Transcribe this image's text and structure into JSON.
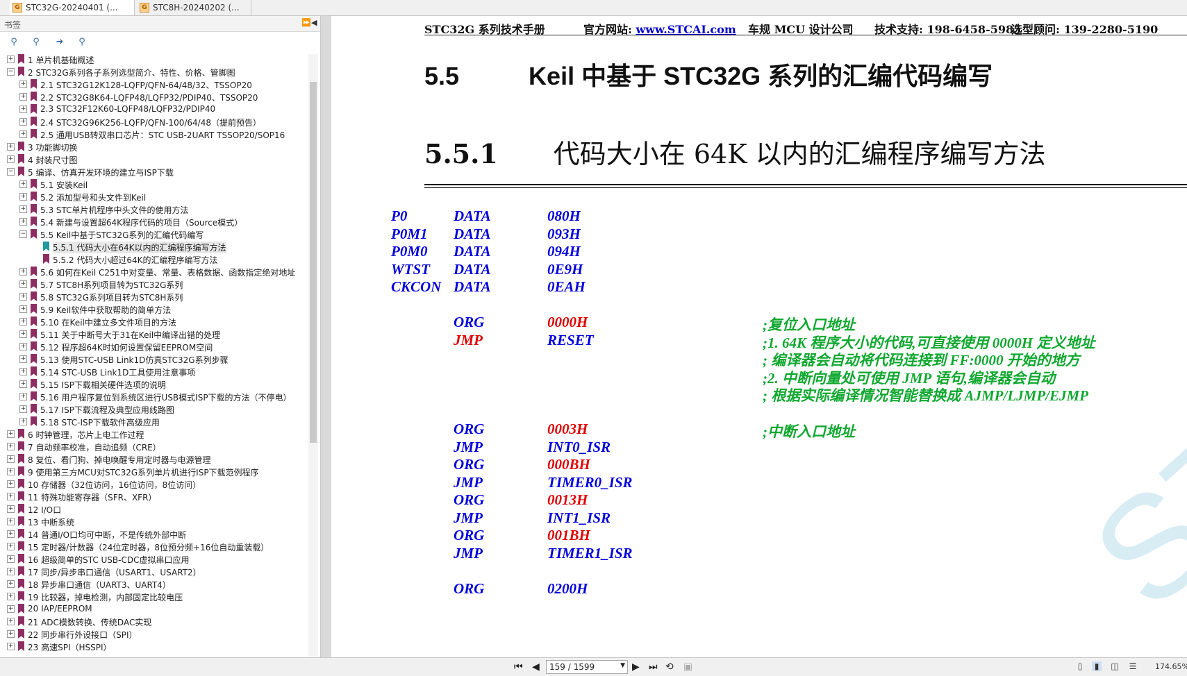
{
  "tabs": [
    {
      "label": "STC32G-20240401 (..."
    },
    {
      "label": "STC8H-20240202 (..."
    }
  ],
  "sidebar": {
    "title": "书签",
    "bookmarks": [
      {
        "text": "1 单片机基础概述",
        "level": 0
      },
      {
        "text": "2  STC32G系列各子系列选型简介、特性、价格、管脚图",
        "level": 0
      },
      {
        "text": "2.1 STC32G12K128-LQFP/QFN-64/48/32、TSSOP20",
        "level": 1
      },
      {
        "text": "2.2  STC32G8K64-LQFP48/LQFP32/PDIP40、TSSOP20",
        "level": 1
      },
      {
        "text": "2.3  STC32F12K60-LQFP48/LQFP32/PDIP40",
        "level": 1
      },
      {
        "text": "2.4  STC32G96K256-LQFP/QFN-100/64/48（提前预告）",
        "level": 1
      },
      {
        "text": "2.5  通用USB转双串口芯片：STC USB-2UART TSSOP20/SOP16",
        "level": 1
      },
      {
        "text": "3  功能脚切换",
        "level": 0
      },
      {
        "text": "4  封装尺寸图",
        "level": 0
      },
      {
        "text": "5  编译、仿真开发环境的建立与ISP下载",
        "level": 0
      },
      {
        "text": "5.1 安装Keil",
        "level": 1
      },
      {
        "text": "5.2  添加型号和头文件到Keil",
        "level": 1
      },
      {
        "text": "5.3  STC单片机程序中头文件的使用方法",
        "level": 1
      },
      {
        "text": "5.4  新建与设置超64K程序代码的项目（Source模式）",
        "level": 1
      },
      {
        "text": "5.5  Keil中基于STC32G系列的汇编代码编写",
        "level": 1
      },
      {
        "text": "5.5.1 代码大小在64K以内的汇编程序编写方法",
        "level": 2
      },
      {
        "text": "5.5.2 代码大小超过64K的汇编程序编写方法",
        "level": 2
      },
      {
        "text": "5.6  如何在Keil C251中对变量、常量、表格数据、函数指定绝对地址",
        "level": 1
      },
      {
        "text": "5.7  STC8H系列项目转为STC32G系列",
        "level": 1
      },
      {
        "text": "5.8  STC32G系列项目转为STC8H系列",
        "level": 1
      },
      {
        "text": "5.9  Keil软件中获取帮助的简单方法",
        "level": 1
      },
      {
        "text": "5.10  在Keil中建立多文件项目的方法",
        "level": 1
      },
      {
        "text": "5.11  关于中断号大于31在Keil中编译出错的处理",
        "level": 1
      },
      {
        "text": "5.12  程序超64K时如何设置保留EEPROM空间",
        "level": 1
      },
      {
        "text": "5.13  使用STC-USB Link1D仿真STC32G系列步骤",
        "level": 1
      },
      {
        "text": "5.14  STC-USB Link1D工具使用注意事项",
        "level": 1
      },
      {
        "text": "5.15  ISP下载相关硬件选项的说明",
        "level": 1
      },
      {
        "text": "5.16  用户程序复位到系统区进行USB模式ISP下载的方法（不停电）",
        "level": 1
      },
      {
        "text": "5.17  ISP下载流程及典型应用线路图",
        "level": 1
      },
      {
        "text": "5.18  STC-ISP下载软件高级应用",
        "level": 1
      },
      {
        "text": "6  时钟管理，芯片上电工作过程",
        "level": 0
      },
      {
        "text": "7  自动频率校准，自动追频（CRE）",
        "level": 0
      },
      {
        "text": "8  复位、看门狗、掉电唤醒专用定时器与电源管理",
        "level": 0
      },
      {
        "text": "9  使用第三方MCU对STC32G系列单片机进行ISP下载范例程序",
        "level": 0
      },
      {
        "text": "10  存储器（32位访问，16位访问，8位访问）",
        "level": 0
      },
      {
        "text": "11  特殊功能寄存器（SFR、XFR）",
        "level": 0
      },
      {
        "text": "12  I/O口",
        "level": 0
      },
      {
        "text": "13  中断系统",
        "level": 0
      },
      {
        "text": "14  普通I/O口均可中断，不是传统外部中断",
        "level": 0
      },
      {
        "text": "15  定时器/计数器（24位定时器，8位预分频+16位自动重装载）",
        "level": 0
      },
      {
        "text": "16  超级简单的STC USB-CDC虚拟串口应用",
        "level": 0
      },
      {
        "text": "17  同步/异步串口通信（USART1、USART2）",
        "level": 0
      },
      {
        "text": "18  异步串口通信（UART3、UART4）",
        "level": 0
      },
      {
        "text": "19  比较器，掉电检测，内部固定比较电压",
        "level": 0
      },
      {
        "text": "20  IAP/EEPROM",
        "level": 0
      },
      {
        "text": "21  ADC模数转换、传统DAC实现",
        "level": 0
      },
      {
        "text": "22  同步串行外设接口（SPI）",
        "level": 0
      },
      {
        "text": "23  高速SPI（HSSPI）",
        "level": 0
      }
    ]
  },
  "doc": {
    "header": {
      "manual": "STC32G 系列技术手册",
      "site_label": "官方网站: ",
      "site_url": "www.STCAI.com",
      "company": "车规 MCU 设计公司",
      "support": "技术支持: 198-6458-5985",
      "advisor": "选型顾问: 139-2280-5190"
    },
    "h1_num": "5.5",
    "h1_title": "Keil 中基于 STC32G 系列的汇编代码编写",
    "h2_num": "5.5.1",
    "h2_title": "代码大小在 64K 以内的汇编程序编写方法",
    "code": {
      "defs": [
        {
          "name": "P0",
          "kw": "DATA",
          "val": "080H"
        },
        {
          "name": "P0M1",
          "kw": "DATA",
          "val": "093H"
        },
        {
          "name": "P0M0",
          "kw": "DATA",
          "val": "094H"
        },
        {
          "name": "WTST",
          "kw": "DATA",
          "val": "0E9H"
        },
        {
          "name": "CKCON",
          "kw": "DATA",
          "val": "0EAH"
        }
      ],
      "reset": {
        "org_kw": "ORG",
        "org_val": "0000H",
        "jmp_kw": "JMP",
        "jmp_val": "RESET",
        "comments": [
          ";复位入口地址",
          ";1.   64K 程序大小的代码,可直接使用 0000H 定义地址",
          ";      编译器会自动将代码连接到 FF:0000 开始的地方",
          ";2.   中断向量处可使用 JMP 语句,编译器会自动",
          ";      根据实际编译情况智能替换成 AJMP/LJMP/EJMP"
        ]
      },
      "vectors_comment": ";中断入口地址",
      "vectors": [
        {
          "kw": "ORG",
          "val": "0003H"
        },
        {
          "kw": "JMP",
          "val": "INT0_ISR"
        },
        {
          "kw": "ORG",
          "val": "000BH"
        },
        {
          "kw": "JMP",
          "val": "TIMER0_ISR"
        },
        {
          "kw": "ORG",
          "val": "0013H"
        },
        {
          "kw": "JMP",
          "val": "INT1_ISR"
        },
        {
          "kw": "ORG",
          "val": "001BH"
        },
        {
          "kw": "JMP",
          "val": "TIMER1_ISR"
        }
      ],
      "last": {
        "kw": "ORG",
        "val": "0200H"
      }
    },
    "watermark": "STC MCU"
  },
  "statusbar": {
    "page": "159 / 1599",
    "zoom": "174.65%"
  }
}
